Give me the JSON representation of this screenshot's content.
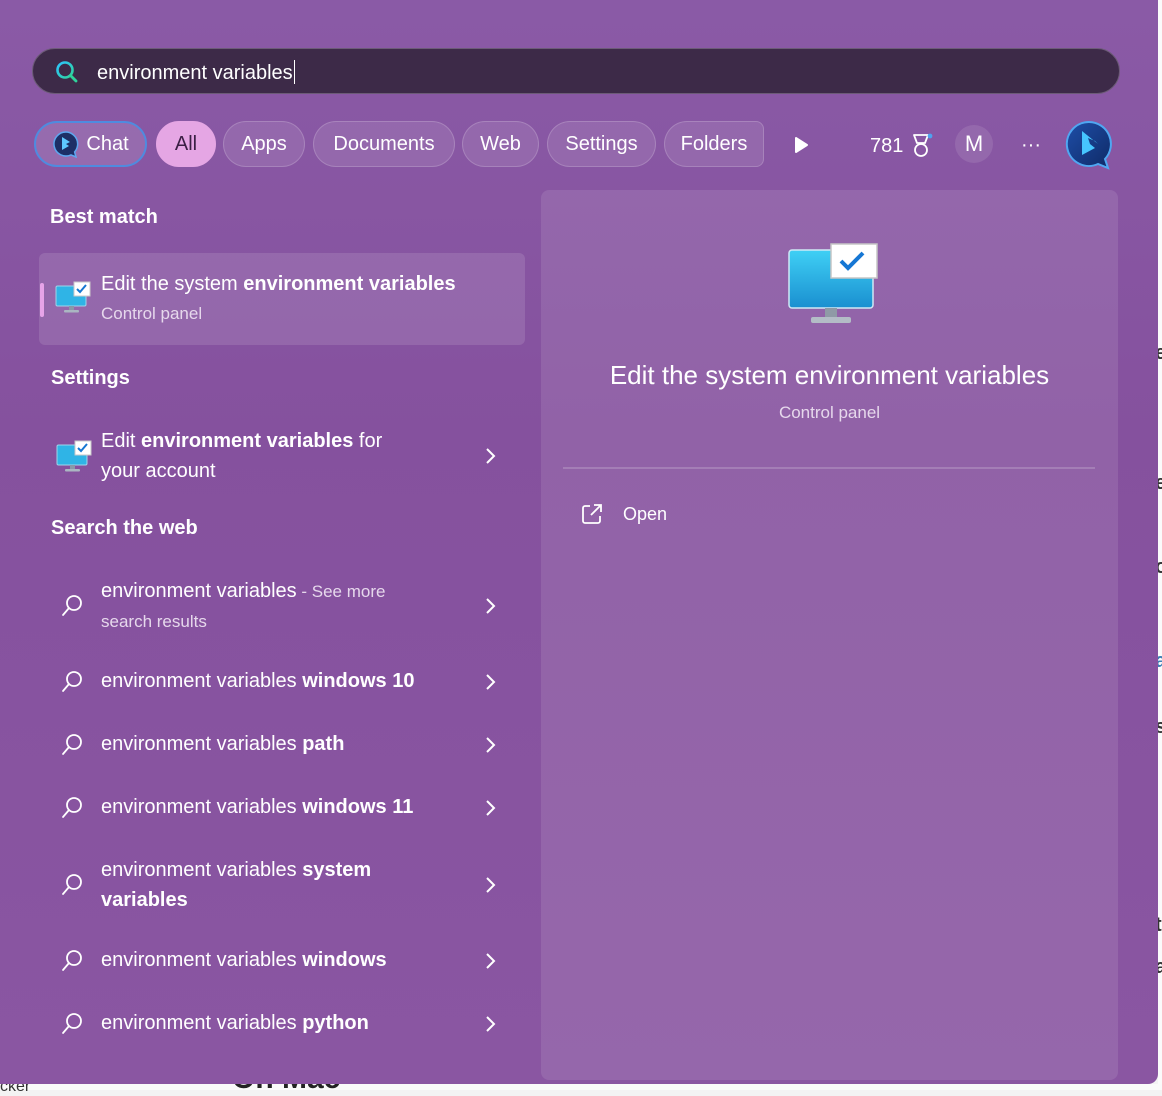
{
  "search": {
    "query": "environment variables"
  },
  "filters": {
    "chat_label": "Chat",
    "tabs": [
      "All",
      "Apps",
      "Documents",
      "Web",
      "Settings",
      "Folders"
    ],
    "active_tab": "All",
    "points": "781",
    "avatar_initial": "M",
    "more_label": "···"
  },
  "best_match": {
    "heading": "Best match",
    "title_plain": "Edit the system ",
    "title_bold": "environment variables",
    "subtitle": "Control panel"
  },
  "settings": {
    "heading": "Settings",
    "line1_plain": "Edit ",
    "line1_bold": "environment variables",
    "line1_tail": " for",
    "line2": "your account"
  },
  "web": {
    "heading": "Search the web",
    "first": {
      "query": "environment variables",
      "hint1": " - See more",
      "hint2": "search results"
    },
    "items": [
      {
        "plain": "environment variables ",
        "bold": "windows 10"
      },
      {
        "plain": "environment variables ",
        "bold": "path"
      },
      {
        "plain": "environment variables ",
        "bold": "windows 11"
      },
      {
        "plain": "environment variables ",
        "bold": "system",
        "line2": "variables"
      },
      {
        "plain": "environment variables ",
        "bold": "windows"
      },
      {
        "plain": "environment variables ",
        "bold": "python"
      }
    ]
  },
  "preview": {
    "title": "Edit the system environment variables",
    "subtitle": "Control panel",
    "open_label": "Open"
  },
  "background": {
    "right_fragments": [
      "e",
      "e",
      "o",
      "a",
      "s",
      "t",
      "a"
    ],
    "bottom_text": "On Mac",
    "bottom_left": "cker"
  },
  "colors": {
    "panel": "#8a56a2",
    "accent": "#e5a6e4",
    "search_bg": "#3d2a48",
    "chat_border": "#4f8bdf"
  },
  "icons": [
    "search-icon",
    "bing-chat-icon",
    "play-icon",
    "trophy-icon",
    "more-icon",
    "bing-icon",
    "system-monitor-icon",
    "chevron-right-icon",
    "web-search-icon",
    "open-external-icon"
  ]
}
